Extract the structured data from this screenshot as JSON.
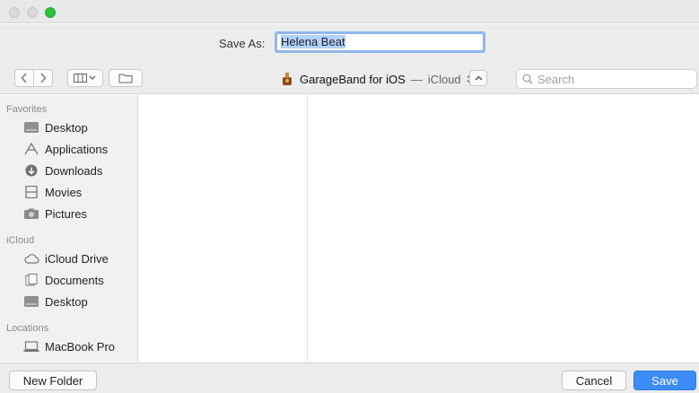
{
  "window": {
    "traffic_zoom_color": "#2dc13f",
    "accent": "#3b8cf5"
  },
  "save_as": {
    "label": "Save As:",
    "value": "Helena Beat"
  },
  "toolbar": {
    "back_icon": "chevron-left-icon",
    "forward_icon": "chevron-right-icon",
    "view_icon": "columns-view-icon",
    "new_folder_icon": "new-folder-icon",
    "location_app": "GarageBand for iOS",
    "location_sep": "—",
    "location_service": "iCloud",
    "search_placeholder": "Search"
  },
  "sidebar": {
    "favorites_header": "Favorites",
    "favorites": [
      {
        "label": "Desktop",
        "icon": "desktop-icon"
      },
      {
        "label": "Applications",
        "icon": "applications-icon"
      },
      {
        "label": "Downloads",
        "icon": "downloads-icon"
      },
      {
        "label": "Movies",
        "icon": "movies-icon"
      },
      {
        "label": "Pictures",
        "icon": "pictures-icon"
      }
    ],
    "icloud_header": "iCloud",
    "icloud": [
      {
        "label": "iCloud Drive",
        "icon": "cloud-icon"
      },
      {
        "label": "Documents",
        "icon": "documents-icon"
      },
      {
        "label": "Desktop",
        "icon": "desktop-icon"
      }
    ],
    "locations_header": "Locations",
    "locations": [
      {
        "label": "MacBook Pro",
        "icon": "laptop-icon"
      }
    ]
  },
  "footer": {
    "new_folder": "New Folder",
    "cancel": "Cancel",
    "save": "Save"
  }
}
